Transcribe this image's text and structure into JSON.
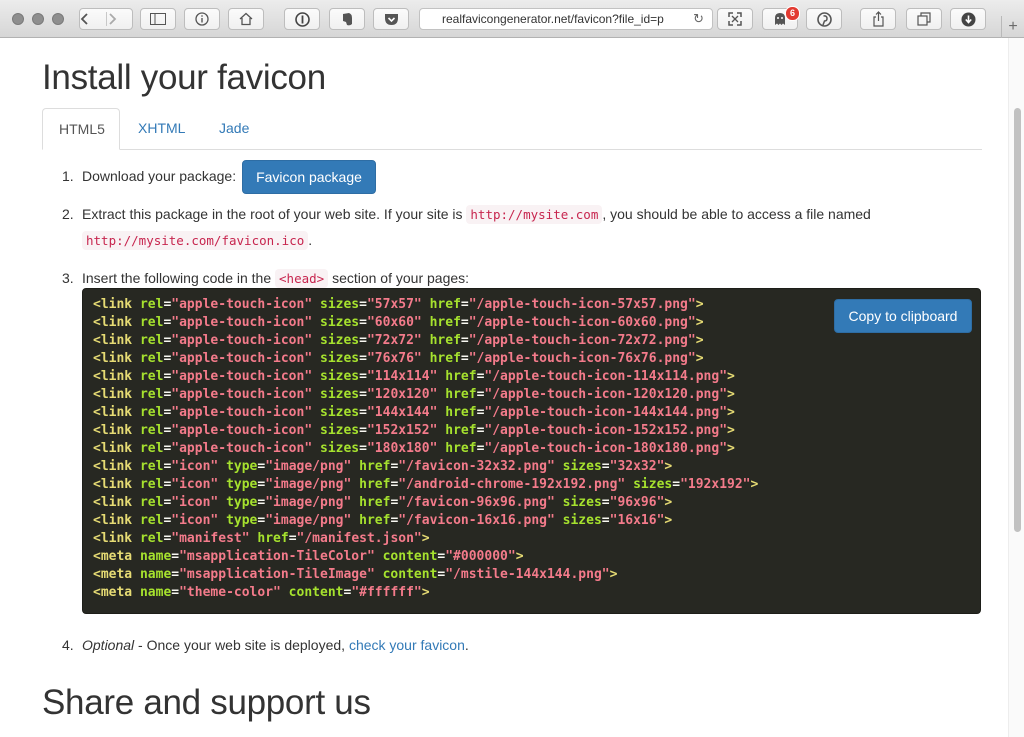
{
  "browser": {
    "url": "realfavicongenerator.net/favicon?file_id=p",
    "extension_badge": "6"
  },
  "page": {
    "title": "Install your favicon",
    "tabs": [
      {
        "label": "HTML5",
        "active": true
      },
      {
        "label": "XHTML",
        "active": false
      },
      {
        "label": "Jade",
        "active": false
      }
    ],
    "steps": {
      "one": {
        "num": "1.",
        "text": "Download your package:",
        "button": "Favicon package"
      },
      "two": {
        "num": "2.",
        "text_a": "Extract this package in the root of your web site. If your site is",
        "code_a": "http://mysite.com",
        "text_b": ", you should be able to access a file named",
        "code_b": "http://mysite.com/favicon.ico",
        "text_c": "."
      },
      "three": {
        "num": "3.",
        "text_a": "Insert the following code in the",
        "code": "<head>",
        "text_b": "section of your pages:"
      },
      "four": {
        "num": "4.",
        "italic": "Optional",
        "text": " - Once your web site is deployed,",
        "link": "check your favicon",
        "text_end": "."
      }
    },
    "copy_button": "Copy to clipboard",
    "code_lines": [
      [
        [
          "t",
          "<link"
        ],
        [
          "a",
          " rel"
        ],
        [
          "p",
          "="
        ],
        [
          "v",
          "\"apple-touch-icon\""
        ],
        [
          "a",
          " sizes"
        ],
        [
          "p",
          "="
        ],
        [
          "v",
          "\"57x57\""
        ],
        [
          "a",
          " href"
        ],
        [
          "p",
          "="
        ],
        [
          "v",
          "\"/apple-touch-icon-57x57.png\""
        ],
        [
          "t",
          ">"
        ]
      ],
      [
        [
          "t",
          "<link"
        ],
        [
          "a",
          " rel"
        ],
        [
          "p",
          "="
        ],
        [
          "v",
          "\"apple-touch-icon\""
        ],
        [
          "a",
          " sizes"
        ],
        [
          "p",
          "="
        ],
        [
          "v",
          "\"60x60\""
        ],
        [
          "a",
          " href"
        ],
        [
          "p",
          "="
        ],
        [
          "v",
          "\"/apple-touch-icon-60x60.png\""
        ],
        [
          "t",
          ">"
        ]
      ],
      [
        [
          "t",
          "<link"
        ],
        [
          "a",
          " rel"
        ],
        [
          "p",
          "="
        ],
        [
          "v",
          "\"apple-touch-icon\""
        ],
        [
          "a",
          " sizes"
        ],
        [
          "p",
          "="
        ],
        [
          "v",
          "\"72x72\""
        ],
        [
          "a",
          " href"
        ],
        [
          "p",
          "="
        ],
        [
          "v",
          "\"/apple-touch-icon-72x72.png\""
        ],
        [
          "t",
          ">"
        ]
      ],
      [
        [
          "t",
          "<link"
        ],
        [
          "a",
          " rel"
        ],
        [
          "p",
          "="
        ],
        [
          "v",
          "\"apple-touch-icon\""
        ],
        [
          "a",
          " sizes"
        ],
        [
          "p",
          "="
        ],
        [
          "v",
          "\"76x76\""
        ],
        [
          "a",
          " href"
        ],
        [
          "p",
          "="
        ],
        [
          "v",
          "\"/apple-touch-icon-76x76.png\""
        ],
        [
          "t",
          ">"
        ]
      ],
      [
        [
          "t",
          "<link"
        ],
        [
          "a",
          " rel"
        ],
        [
          "p",
          "="
        ],
        [
          "v",
          "\"apple-touch-icon\""
        ],
        [
          "a",
          " sizes"
        ],
        [
          "p",
          "="
        ],
        [
          "v",
          "\"114x114\""
        ],
        [
          "a",
          " href"
        ],
        [
          "p",
          "="
        ],
        [
          "v",
          "\"/apple-touch-icon-114x114.png\""
        ],
        [
          "t",
          ">"
        ]
      ],
      [
        [
          "t",
          "<link"
        ],
        [
          "a",
          " rel"
        ],
        [
          "p",
          "="
        ],
        [
          "v",
          "\"apple-touch-icon\""
        ],
        [
          "a",
          " sizes"
        ],
        [
          "p",
          "="
        ],
        [
          "v",
          "\"120x120\""
        ],
        [
          "a",
          " href"
        ],
        [
          "p",
          "="
        ],
        [
          "v",
          "\"/apple-touch-icon-120x120.png\""
        ],
        [
          "t",
          ">"
        ]
      ],
      [
        [
          "t",
          "<link"
        ],
        [
          "a",
          " rel"
        ],
        [
          "p",
          "="
        ],
        [
          "v",
          "\"apple-touch-icon\""
        ],
        [
          "a",
          " sizes"
        ],
        [
          "p",
          "="
        ],
        [
          "v",
          "\"144x144\""
        ],
        [
          "a",
          " href"
        ],
        [
          "p",
          "="
        ],
        [
          "v",
          "\"/apple-touch-icon-144x144.png\""
        ],
        [
          "t",
          ">"
        ]
      ],
      [
        [
          "t",
          "<link"
        ],
        [
          "a",
          " rel"
        ],
        [
          "p",
          "="
        ],
        [
          "v",
          "\"apple-touch-icon\""
        ],
        [
          "a",
          " sizes"
        ],
        [
          "p",
          "="
        ],
        [
          "v",
          "\"152x152\""
        ],
        [
          "a",
          " href"
        ],
        [
          "p",
          "="
        ],
        [
          "v",
          "\"/apple-touch-icon-152x152.png\""
        ],
        [
          "t",
          ">"
        ]
      ],
      [
        [
          "t",
          "<link"
        ],
        [
          "a",
          " rel"
        ],
        [
          "p",
          "="
        ],
        [
          "v",
          "\"apple-touch-icon\""
        ],
        [
          "a",
          " sizes"
        ],
        [
          "p",
          "="
        ],
        [
          "v",
          "\"180x180\""
        ],
        [
          "a",
          " href"
        ],
        [
          "p",
          "="
        ],
        [
          "v",
          "\"/apple-touch-icon-180x180.png\""
        ],
        [
          "t",
          ">"
        ]
      ],
      [
        [
          "t",
          "<link"
        ],
        [
          "a",
          " rel"
        ],
        [
          "p",
          "="
        ],
        [
          "v",
          "\"icon\""
        ],
        [
          "a",
          " type"
        ],
        [
          "p",
          "="
        ],
        [
          "v",
          "\"image/png\""
        ],
        [
          "a",
          " href"
        ],
        [
          "p",
          "="
        ],
        [
          "v",
          "\"/favicon-32x32.png\""
        ],
        [
          "a",
          " sizes"
        ],
        [
          "p",
          "="
        ],
        [
          "v",
          "\"32x32\""
        ],
        [
          "t",
          ">"
        ]
      ],
      [
        [
          "t",
          "<link"
        ],
        [
          "a",
          " rel"
        ],
        [
          "p",
          "="
        ],
        [
          "v",
          "\"icon\""
        ],
        [
          "a",
          " type"
        ],
        [
          "p",
          "="
        ],
        [
          "v",
          "\"image/png\""
        ],
        [
          "a",
          " href"
        ],
        [
          "p",
          "="
        ],
        [
          "v",
          "\"/android-chrome-192x192.png\""
        ],
        [
          "a",
          " sizes"
        ],
        [
          "p",
          "="
        ],
        [
          "v",
          "\"192x192\""
        ],
        [
          "t",
          ">"
        ]
      ],
      [
        [
          "t",
          "<link"
        ],
        [
          "a",
          " rel"
        ],
        [
          "p",
          "="
        ],
        [
          "v",
          "\"icon\""
        ],
        [
          "a",
          " type"
        ],
        [
          "p",
          "="
        ],
        [
          "v",
          "\"image/png\""
        ],
        [
          "a",
          " href"
        ],
        [
          "p",
          "="
        ],
        [
          "v",
          "\"/favicon-96x96.png\""
        ],
        [
          "a",
          " sizes"
        ],
        [
          "p",
          "="
        ],
        [
          "v",
          "\"96x96\""
        ],
        [
          "t",
          ">"
        ]
      ],
      [
        [
          "t",
          "<link"
        ],
        [
          "a",
          " rel"
        ],
        [
          "p",
          "="
        ],
        [
          "v",
          "\"icon\""
        ],
        [
          "a",
          " type"
        ],
        [
          "p",
          "="
        ],
        [
          "v",
          "\"image/png\""
        ],
        [
          "a",
          " href"
        ],
        [
          "p",
          "="
        ],
        [
          "v",
          "\"/favicon-16x16.png\""
        ],
        [
          "a",
          " sizes"
        ],
        [
          "p",
          "="
        ],
        [
          "v",
          "\"16x16\""
        ],
        [
          "t",
          ">"
        ]
      ],
      [
        [
          "t",
          "<link"
        ],
        [
          "a",
          " rel"
        ],
        [
          "p",
          "="
        ],
        [
          "v",
          "\"manifest\""
        ],
        [
          "a",
          " href"
        ],
        [
          "p",
          "="
        ],
        [
          "v",
          "\"/manifest.json\""
        ],
        [
          "t",
          ">"
        ]
      ],
      [
        [
          "t",
          "<meta"
        ],
        [
          "a",
          " name"
        ],
        [
          "p",
          "="
        ],
        [
          "v",
          "\"msapplication-TileColor\""
        ],
        [
          "a",
          " content"
        ],
        [
          "p",
          "="
        ],
        [
          "v",
          "\"#000000\""
        ],
        [
          "t",
          ">"
        ]
      ],
      [
        [
          "t",
          "<meta"
        ],
        [
          "a",
          " name"
        ],
        [
          "p",
          "="
        ],
        [
          "v",
          "\"msapplication-TileImage\""
        ],
        [
          "a",
          " content"
        ],
        [
          "p",
          "="
        ],
        [
          "v",
          "\"/mstile-144x144.png\""
        ],
        [
          "t",
          ">"
        ]
      ],
      [
        [
          "t",
          "<meta"
        ],
        [
          "a",
          " name"
        ],
        [
          "p",
          "="
        ],
        [
          "v",
          "\"theme-color\""
        ],
        [
          "a",
          " content"
        ],
        [
          "p",
          "="
        ],
        [
          "v",
          "\"#ffffff\""
        ],
        [
          "t",
          ">"
        ]
      ]
    ],
    "share_title": "Share and support us"
  },
  "colors": {
    "link": "#337ab7",
    "code_bg": "#272822",
    "code_tag": "#e6db74",
    "code_attr": "#a6e22e",
    "code_value": "#f47b8b",
    "inline_code_fg": "#c7254e",
    "inline_code_bg": "#f9f2f4"
  },
  "icons": [
    "back-icon",
    "forward-icon",
    "sidebar-icon",
    "info-icon",
    "home-icon",
    "onepassword-icon",
    "evernote-icon",
    "pocket-icon",
    "reader-icon",
    "ghostery-icon",
    "pinterest-icon",
    "share-icon",
    "tabs-icon",
    "download-icon",
    "reload-icon",
    "new-tab-icon"
  ]
}
